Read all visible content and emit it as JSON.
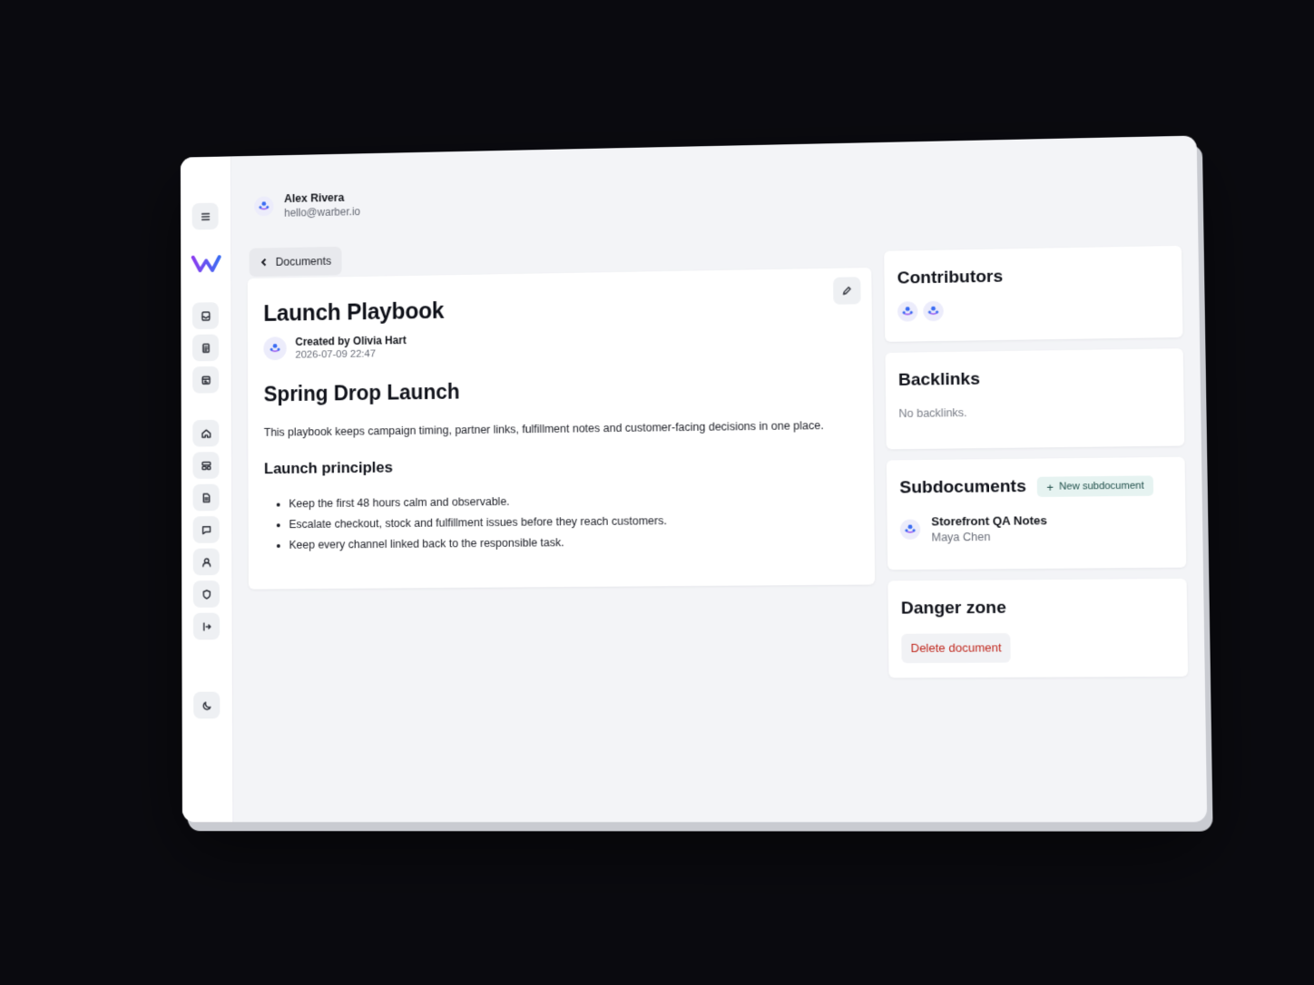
{
  "header": {
    "user_name": "Alex Rivera",
    "user_email": "hello@warber.io",
    "back_label": "Documents"
  },
  "rail": {
    "menu_icon": "menu-icon",
    "logo": "warber-logo",
    "top_icons": [
      "inbox-icon",
      "clipboard-icon",
      "calendar-icon"
    ],
    "nav_icons": [
      "home-icon",
      "layout-icon",
      "document-icon",
      "chat-icon",
      "user-icon",
      "shield-icon",
      "logout-icon"
    ],
    "theme_icon": "moon-icon"
  },
  "document": {
    "title": "Launch Playbook",
    "created_by": "Created by Olivia Hart",
    "created_at": "2026-07-09 22:47",
    "heading": "Spring Drop Launch",
    "intro": "This playbook keeps campaign timing, partner links, fulfillment notes and customer-facing decisions in one place.",
    "subheading": "Launch principles",
    "bullets": [
      "Keep the first 48 hours calm and observable.",
      "Escalate checkout, stock and fulfillment issues before they reach customers.",
      "Keep every channel linked back to the responsible task."
    ]
  },
  "contributors": {
    "title": "Contributors"
  },
  "backlinks": {
    "title": "Backlinks",
    "empty_text": "No backlinks."
  },
  "subdocuments": {
    "title": "Subdocuments",
    "new_label": "New subdocument",
    "items": [
      {
        "name": "Storefront QA Notes",
        "author": "Maya Chen"
      }
    ]
  },
  "danger": {
    "title": "Danger zone",
    "delete_label": "Delete document"
  },
  "colors": {
    "accent_blue": "#3b6cf2",
    "accent_purple": "#8a3df0",
    "danger_red": "#c0291f",
    "teal_badge": "#e6f3f1"
  }
}
